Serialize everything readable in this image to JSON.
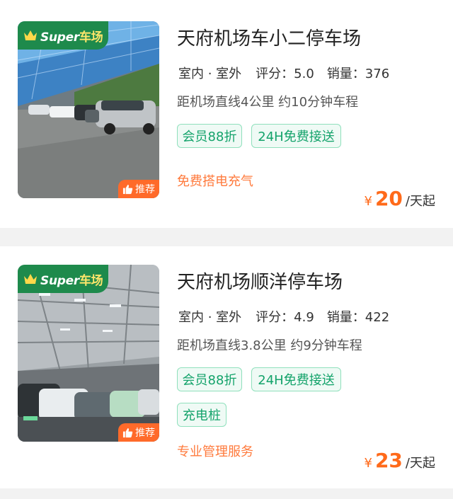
{
  "colors": {
    "brand_green": "#1e8a4c",
    "tag_green": "#14a36b",
    "orange": "#ff6a1a",
    "recommend_orange": "#ff6a2a"
  },
  "listings": [
    {
      "badge": {
        "latin": "Super",
        "cn": "车场"
      },
      "recommend": "推荐",
      "title": "天府机场车小二停车场",
      "location": "室内 · 室外",
      "score": "评分：5.0",
      "sales": "销量：376",
      "distance": "距机场直线4公里 约10分钟车程",
      "tags": [
        "会员88折",
        "24H免费接送"
      ],
      "promo": "免费搭电充气",
      "price": {
        "symbol": "¥",
        "amount": "20",
        "unit": "/天起"
      }
    },
    {
      "badge": {
        "latin": "Super",
        "cn": "车场"
      },
      "recommend": "推荐",
      "title": "天府机场顺洋停车场",
      "location": "室内 · 室外",
      "score": "评分：4.9",
      "sales": "销量：422",
      "distance": "距机场直线3.8公里 约9分钟车程",
      "tags": [
        "会员88折",
        "24H免费接送",
        "充电桩"
      ],
      "promo": "专业管理服务",
      "price": {
        "symbol": "¥",
        "amount": "23",
        "unit": "/天起"
      }
    }
  ]
}
